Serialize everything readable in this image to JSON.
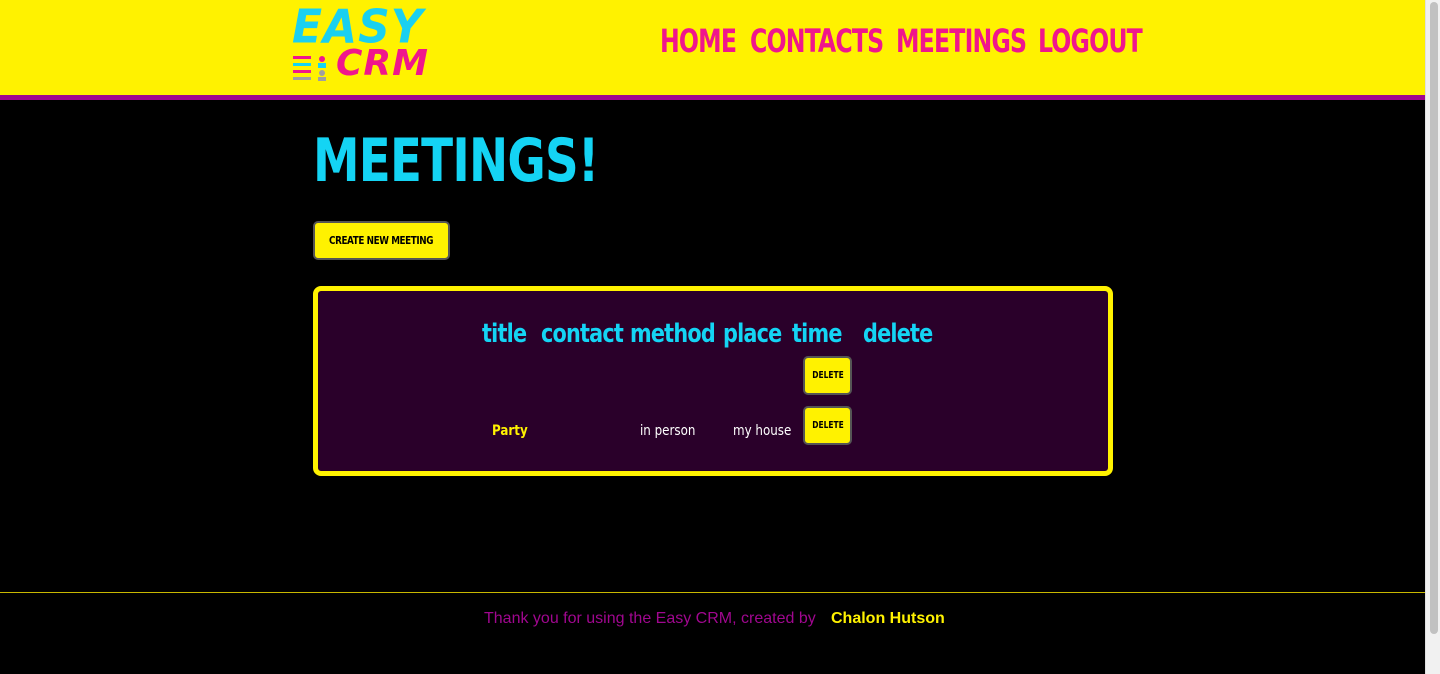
{
  "header": {
    "logo": {
      "line1": "EASY",
      "line2": "CRM"
    },
    "nav": [
      {
        "label": "HOME"
      },
      {
        "label": "CONTACTS"
      },
      {
        "label": "MEETINGS"
      },
      {
        "label": "LOGOUT"
      }
    ]
  },
  "main": {
    "page_title": "MEETINGS!",
    "create_button": "CREATE NEW MEETING",
    "table": {
      "headers": [
        "title",
        "contact",
        "method",
        "place",
        "time",
        "delete"
      ],
      "rows": [
        {
          "title": "",
          "contact": "",
          "method": "",
          "place": "",
          "time": "",
          "delete": "DELETE"
        },
        {
          "title": "Party",
          "contact": "",
          "method": "in person",
          "place": "my house",
          "time": "",
          "delete": "DELETE"
        }
      ]
    }
  },
  "footer": {
    "thanks": "Thank you for using the Easy CRM, created by",
    "author": "Chalon Hutson"
  },
  "colors": {
    "header_bg": "#fff200",
    "accent_pink": "#f0168c",
    "accent_cyan": "#14d4f4",
    "accent_purple": "#a0078f",
    "table_bg": "#2a002a"
  }
}
